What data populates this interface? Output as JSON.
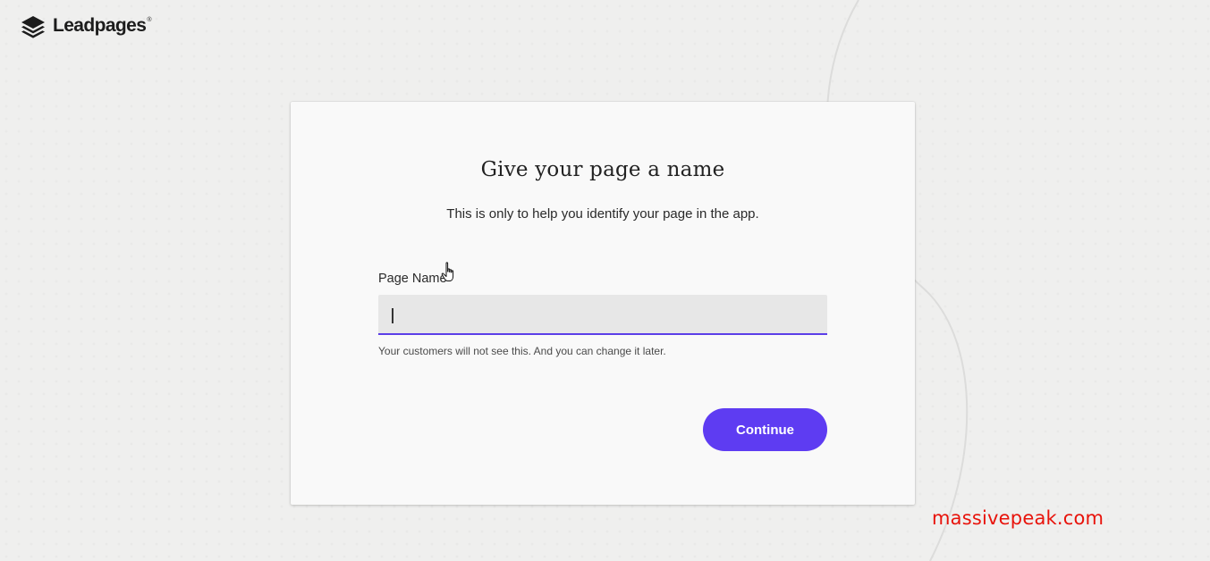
{
  "brand": {
    "name": "Leadpages",
    "trademark": "®",
    "icon": "stacked-layers-logo"
  },
  "dialog": {
    "title": "Give your page a name",
    "subtitle": "This is only to help you identify your page in the app.",
    "field": {
      "label": "Page Name",
      "value": "",
      "helper": "Your customers will not see this. And you can change it later."
    },
    "continue_label": "Continue"
  },
  "watermark": "massivepeak.com",
  "colors": {
    "accent": "#5e3cf2",
    "background": "#efefee",
    "card": "#f9f9f9",
    "watermark": "#e8130b"
  }
}
